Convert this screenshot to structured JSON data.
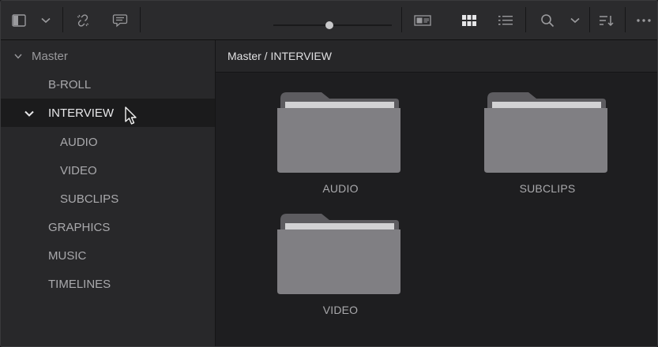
{
  "toolbar": {
    "icons": [
      "sidebar-toggle-icon",
      "chevron-down-icon",
      "unlink-icon",
      "metadata-icon",
      "zoom-slider",
      "thumbnail-view-icon",
      "grid-view-icon",
      "list-view-icon",
      "search-icon",
      "chevron-down-icon",
      "sort-icon",
      "more-icon"
    ],
    "zoom_level": 0.47
  },
  "sidebar": {
    "root_label": "Master",
    "items": [
      {
        "label": "B-ROLL"
      },
      {
        "label": "INTERVIEW",
        "selected": true,
        "expanded": true
      },
      {
        "label": "AUDIO"
      },
      {
        "label": "VIDEO"
      },
      {
        "label": "SUBCLIPS"
      },
      {
        "label": "GRAPHICS"
      },
      {
        "label": "MUSIC"
      },
      {
        "label": "TIMELINES"
      }
    ]
  },
  "main": {
    "breadcrumb": "Master / INTERVIEW",
    "folders": [
      {
        "label": "AUDIO"
      },
      {
        "label": "SUBCLIPS"
      },
      {
        "label": "VIDEO"
      }
    ]
  },
  "colors": {
    "toolbar_bg": "#2b2b2d",
    "sidebar_bg": "#28282a",
    "selected_row_bg": "#1b1b1c",
    "folder": "#807f83"
  }
}
